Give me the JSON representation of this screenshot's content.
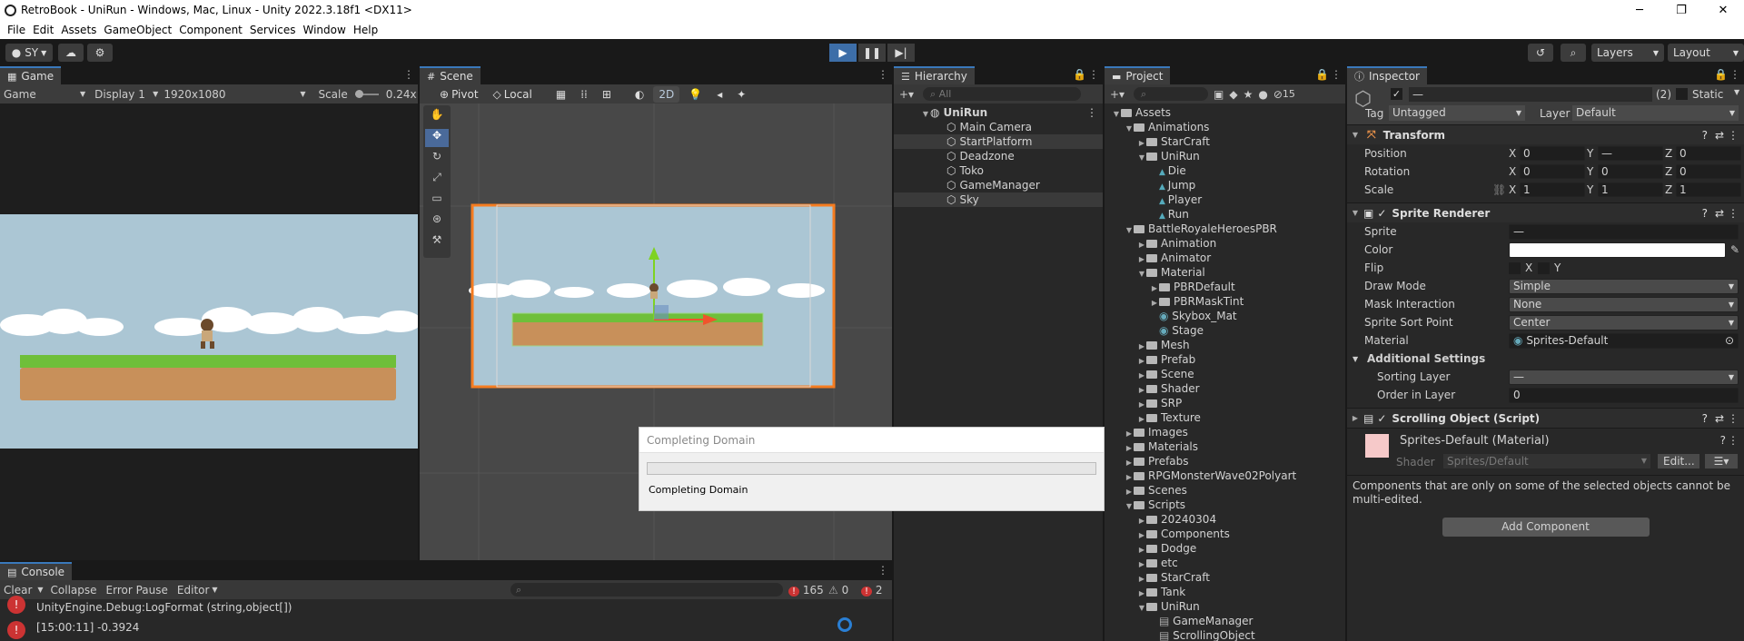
{
  "window": {
    "title": "RetroBook - UniRun - Windows, Mac, Linux - Unity 2022.3.18f1 <DX11>",
    "min": "─",
    "max": "❐",
    "close": "✕"
  },
  "menu": [
    "File",
    "Edit",
    "Assets",
    "GameObject",
    "Component",
    "Services",
    "Window",
    "Help"
  ],
  "toolbar": {
    "account": "SY",
    "layers": "Layers",
    "layout": "Layout"
  },
  "game": {
    "tab": "Game",
    "mode": "Game",
    "display": "Display 1",
    "resolution": "1920x1080",
    "scale_label": "Scale",
    "scale_value": "0.24x"
  },
  "scene": {
    "tab": "Scene",
    "pivot": "Pivot",
    "local": "Local",
    "mode2d": "2D"
  },
  "hierarchy": {
    "tab": "Hierarchy",
    "search_placeholder": "All",
    "root": "UniRun",
    "items": [
      "Main Camera",
      "StartPlatform",
      "Deadzone",
      "Toko",
      "GameManager",
      "Sky"
    ]
  },
  "project": {
    "tab": "Project",
    "hidden_count": "15",
    "items": [
      {
        "label": "Assets",
        "indent": 0,
        "open": true
      },
      {
        "label": "Animations",
        "indent": 1,
        "open": true
      },
      {
        "label": "StarCraft",
        "indent": 2,
        "open": false
      },
      {
        "label": "UniRun",
        "indent": 2,
        "open": true
      },
      {
        "label": "Die",
        "indent": 3,
        "anim": true
      },
      {
        "label": "Jump",
        "indent": 3,
        "anim": true
      },
      {
        "label": "Player",
        "indent": 3,
        "anim": true
      },
      {
        "label": "Run",
        "indent": 3,
        "anim": true
      },
      {
        "label": "BattleRoyaleHeroesPBR",
        "indent": 1,
        "open": true
      },
      {
        "label": "Animation",
        "indent": 2,
        "open": false
      },
      {
        "label": "Animator",
        "indent": 2,
        "open": false
      },
      {
        "label": "Material",
        "indent": 2,
        "open": true
      },
      {
        "label": "PBRDefault",
        "indent": 3,
        "open": false
      },
      {
        "label": "PBRMaskTint",
        "indent": 3,
        "open": false
      },
      {
        "label": "Skybox_Mat",
        "indent": 3,
        "mat": true
      },
      {
        "label": "Stage",
        "indent": 3,
        "mat": true
      },
      {
        "label": "Mesh",
        "indent": 2,
        "open": false
      },
      {
        "label": "Prefab",
        "indent": 2,
        "open": false
      },
      {
        "label": "Scene",
        "indent": 2,
        "open": false
      },
      {
        "label": "Shader",
        "indent": 2,
        "open": false
      },
      {
        "label": "SRP",
        "indent": 2,
        "open": false
      },
      {
        "label": "Texture",
        "indent": 2,
        "open": false
      },
      {
        "label": "Images",
        "indent": 1,
        "open": false
      },
      {
        "label": "Materials",
        "indent": 1,
        "open": false
      },
      {
        "label": "Prefabs",
        "indent": 1,
        "open": false
      },
      {
        "label": "RPGMonsterWave02Polyart",
        "indent": 1,
        "open": false
      },
      {
        "label": "Scenes",
        "indent": 1,
        "open": false
      },
      {
        "label": "Scripts",
        "indent": 1,
        "open": true
      },
      {
        "label": "20240304",
        "indent": 2,
        "open": false
      },
      {
        "label": "Components",
        "indent": 2,
        "open": false
      },
      {
        "label": "Dodge",
        "indent": 2,
        "open": false
      },
      {
        "label": "etc",
        "indent": 2,
        "open": false
      },
      {
        "label": "StarCraft",
        "indent": 2,
        "open": false
      },
      {
        "label": "Tank",
        "indent": 2,
        "open": false
      },
      {
        "label": "UniRun",
        "indent": 2,
        "open": true
      },
      {
        "label": "GameManager",
        "indent": 3,
        "script": true
      },
      {
        "label": "ScrollingObject",
        "indent": 3,
        "script": true
      }
    ]
  },
  "inspector": {
    "tab": "Inspector",
    "name": "—",
    "count": "(2)",
    "static": "Static",
    "tag_label": "Tag",
    "tag": "Untagged",
    "layer_label": "Layer",
    "layer": "Default",
    "transform": {
      "title": "Transform",
      "position": "Position",
      "rotation": "Rotation",
      "scale": "Scale",
      "pos": [
        "0",
        "—",
        "0"
      ],
      "rot": [
        "0",
        "0",
        "0"
      ],
      "scl": [
        "1",
        "1",
        "1"
      ]
    },
    "sprite": {
      "title": "Sprite Renderer",
      "sprite_label": "Sprite",
      "sprite": "—",
      "color_label": "Color",
      "flip_label": "Flip",
      "flip_x": "X",
      "flip_y": "Y",
      "draw_mode_label": "Draw Mode",
      "draw_mode": "Simple",
      "mask_label": "Mask Interaction",
      "mask": "None",
      "sort_label": "Sprite Sort Point",
      "sort": "Center",
      "material_label": "Material",
      "material": "Sprites-Default",
      "additional": "Additional Settings",
      "sorting_layer_label": "Sorting Layer",
      "sorting_layer": "—",
      "order_label": "Order in Layer",
      "order": "0"
    },
    "script": {
      "title": "Scrolling Object (Script)"
    },
    "material": {
      "name": "Sprites-Default (Material)",
      "shader_label": "Shader",
      "shader": "Sprites/Default",
      "edit": "Edit..."
    },
    "note": "Components that are only on some of the selected objects cannot be multi-edited.",
    "add_component": "Add Component"
  },
  "console": {
    "tab": "Console",
    "clear": "Clear",
    "collapse": "Collapse",
    "error_pause": "Error Pause",
    "editor": "Editor",
    "log_count": "165",
    "warn_count": "0",
    "err_count": "2",
    "lines": [
      "UnityEngine.Debug:LogFormat (string,object[])",
      "[15:00:11] -0.3924",
      "UnityEngine.Debug:LogFormat (string,object[])"
    ]
  },
  "dialog": {
    "title": "Completing Domain",
    "message": "Completing Domain"
  },
  "colors": {
    "accent": "#3a79bb",
    "sky": "#abc6d4",
    "grass": "#6fbf3a",
    "dirt": "#c8905a",
    "selection": "#f57c20"
  }
}
